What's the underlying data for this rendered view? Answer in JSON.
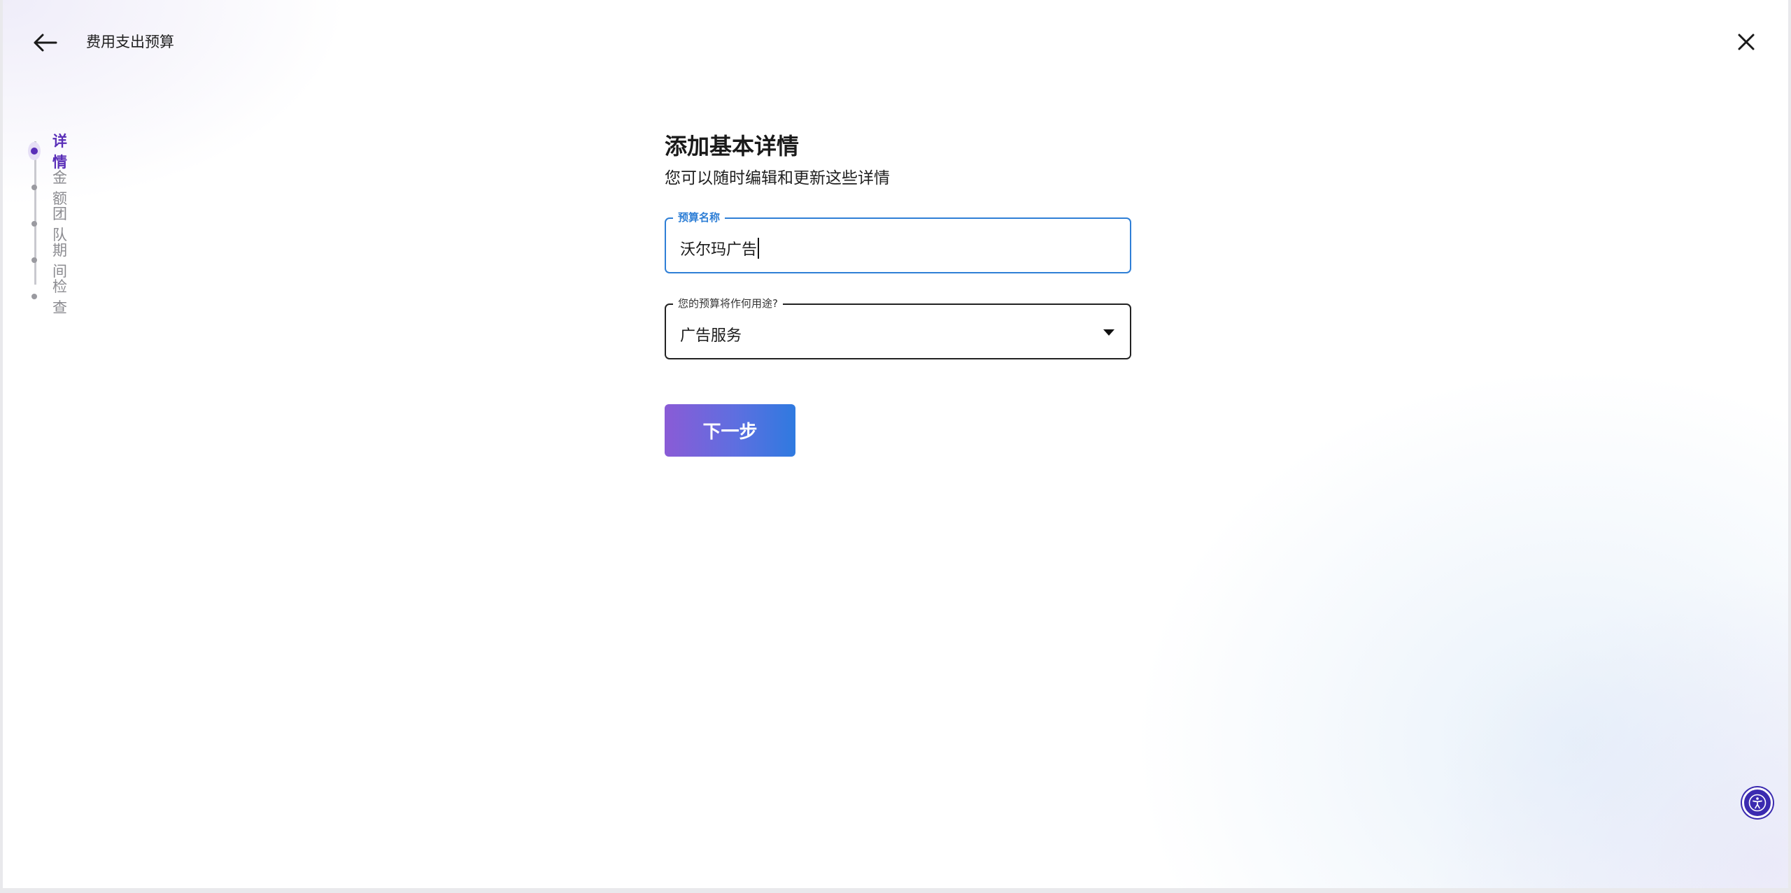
{
  "header": {
    "title": "费用支出预算",
    "back_icon": "arrow-left-icon",
    "close_icon": "close-icon"
  },
  "stepper": {
    "steps": [
      {
        "label": "详情",
        "active": true
      },
      {
        "label": "金额",
        "active": false
      },
      {
        "label": "团队",
        "active": false
      },
      {
        "label": "期间",
        "active": false
      },
      {
        "label": "检查",
        "active": false
      }
    ]
  },
  "form": {
    "title": "添加基本详情",
    "subtitle": "您可以随时编辑和更新这些详情",
    "budget_name": {
      "label": "预算名称",
      "value": "沃尔玛广告"
    },
    "purpose": {
      "label": "您的预算将作何用途?",
      "value": "广告服务"
    },
    "next_label": "下一步"
  },
  "colors": {
    "accent_purple": "#5a2fb8",
    "focus_blue": "#2f7fd6",
    "button_gradient_start": "#8a5bd6",
    "button_gradient_end": "#2f7ae0",
    "a11y_button": "#3b2bb0"
  },
  "accessibility": {
    "icon": "accessibility-icon"
  }
}
